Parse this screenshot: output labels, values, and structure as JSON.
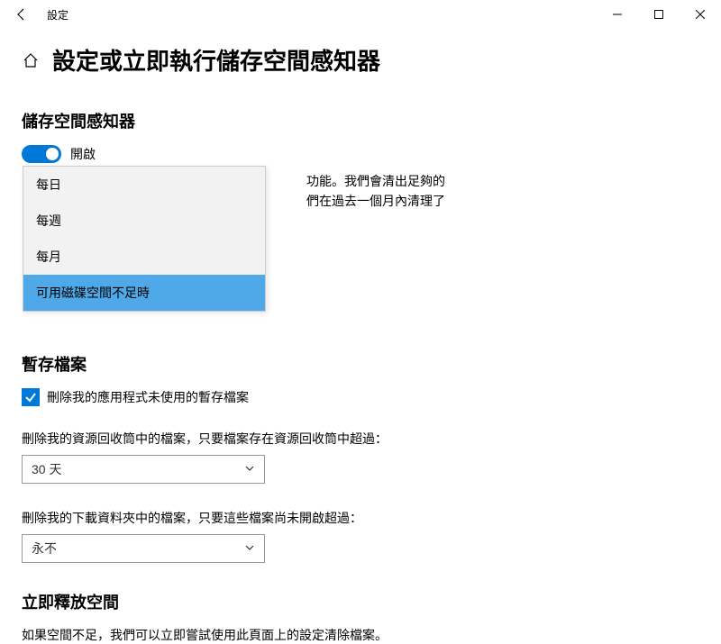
{
  "titlebar": {
    "title": "設定"
  },
  "page": {
    "title": "設定或立即執行儲存空間感知器"
  },
  "storageSense": {
    "heading": "儲存空間感知器",
    "toggleLabel": "開啟",
    "bgTextLine1": "功能。我們會清出足夠的",
    "bgTextLine2": "們在過去一個月內清理了"
  },
  "dropdown": {
    "items": [
      "每日",
      "每週",
      "每月",
      "可用磁碟空間不足時"
    ]
  },
  "tempFiles": {
    "heading": "暫存檔案",
    "checkboxLabel": "刪除我的應用程式未使用的暫存檔案",
    "recycleLabel": "刪除我的資源回收筒中的檔案，只要檔案存在資源回收筒中超過：",
    "recycleValue": "30 天",
    "downloadsLabel": "刪除我的下載資料夾中的檔案，只要這些檔案尚未開啟超過：",
    "downloadsValue": "永不"
  },
  "freeNow": {
    "heading": "立即釋放空間",
    "description": "如果空間不足，我們可以立即嘗試使用此頁面上的設定清除檔案。"
  }
}
